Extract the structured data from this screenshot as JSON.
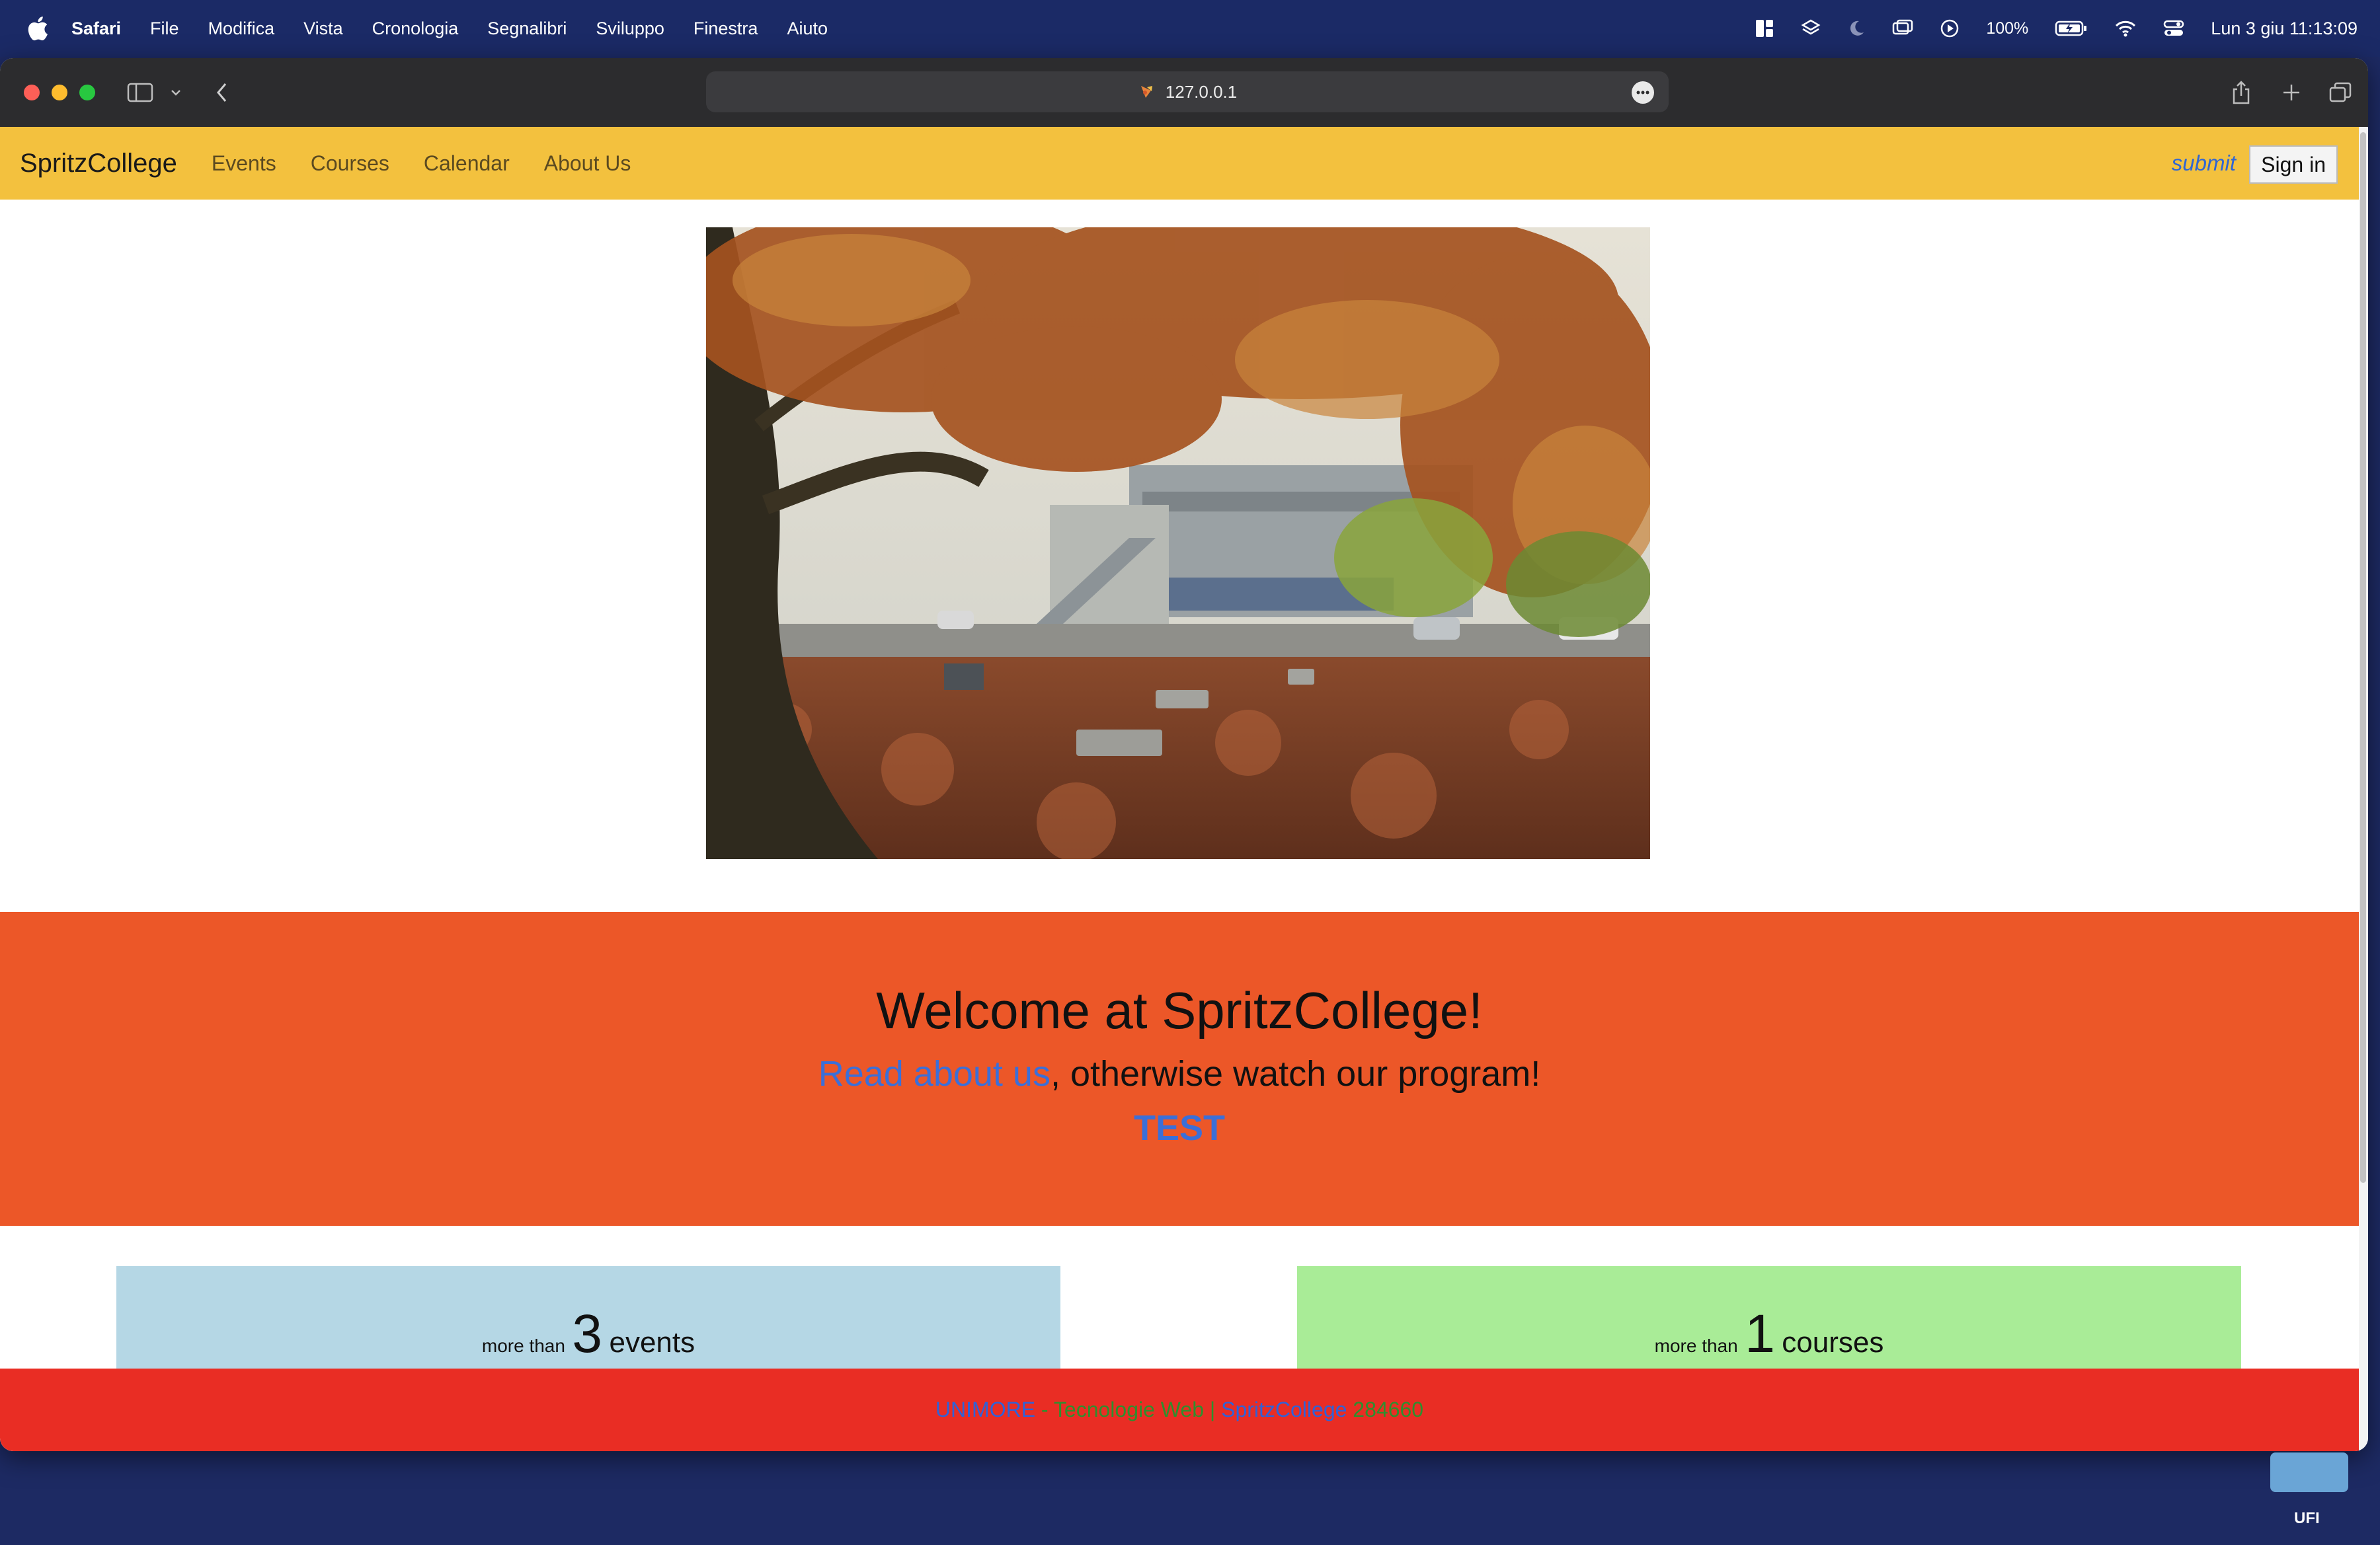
{
  "menubar": {
    "app": "Safari",
    "items": [
      "File",
      "Modifica",
      "Vista",
      "Cronologia",
      "Segnalibri",
      "Sviluppo",
      "Finestra",
      "Aiuto"
    ],
    "battery": "100%",
    "clock": "Lun 3 giu  11:13:09"
  },
  "browser": {
    "url": "127.0.0.1"
  },
  "site": {
    "brand": "SpritzCollege",
    "nav": [
      "Events",
      "Courses",
      "Calendar",
      "About Us"
    ],
    "submit": "submit",
    "signin": "Sign in"
  },
  "welcome": {
    "title": "Welcome at SpritzCollege!",
    "read_link": "Read about us",
    "line2_rest": ", otherwise watch our program!",
    "test_link": "TEST"
  },
  "cards": {
    "events": {
      "prefix": "more than",
      "count": "3",
      "label": "events"
    },
    "courses": {
      "prefix": "more than",
      "count": "1",
      "label": "courses"
    }
  },
  "footer": {
    "part1": "UNIMORE",
    "part2": " - Tecnologie Web | ",
    "part3": "SpritzCollege",
    "part4": " 284660"
  },
  "dock": {
    "label": "UFI"
  },
  "colors": {
    "menubar": "#1b2a66",
    "navbar": "#f3c13e",
    "welcome_band": "#ec5728",
    "events_card": "#b5d7e5",
    "courses_card": "#a9ec97",
    "footer": "#e92d24",
    "link": "#3b6fd8"
  }
}
